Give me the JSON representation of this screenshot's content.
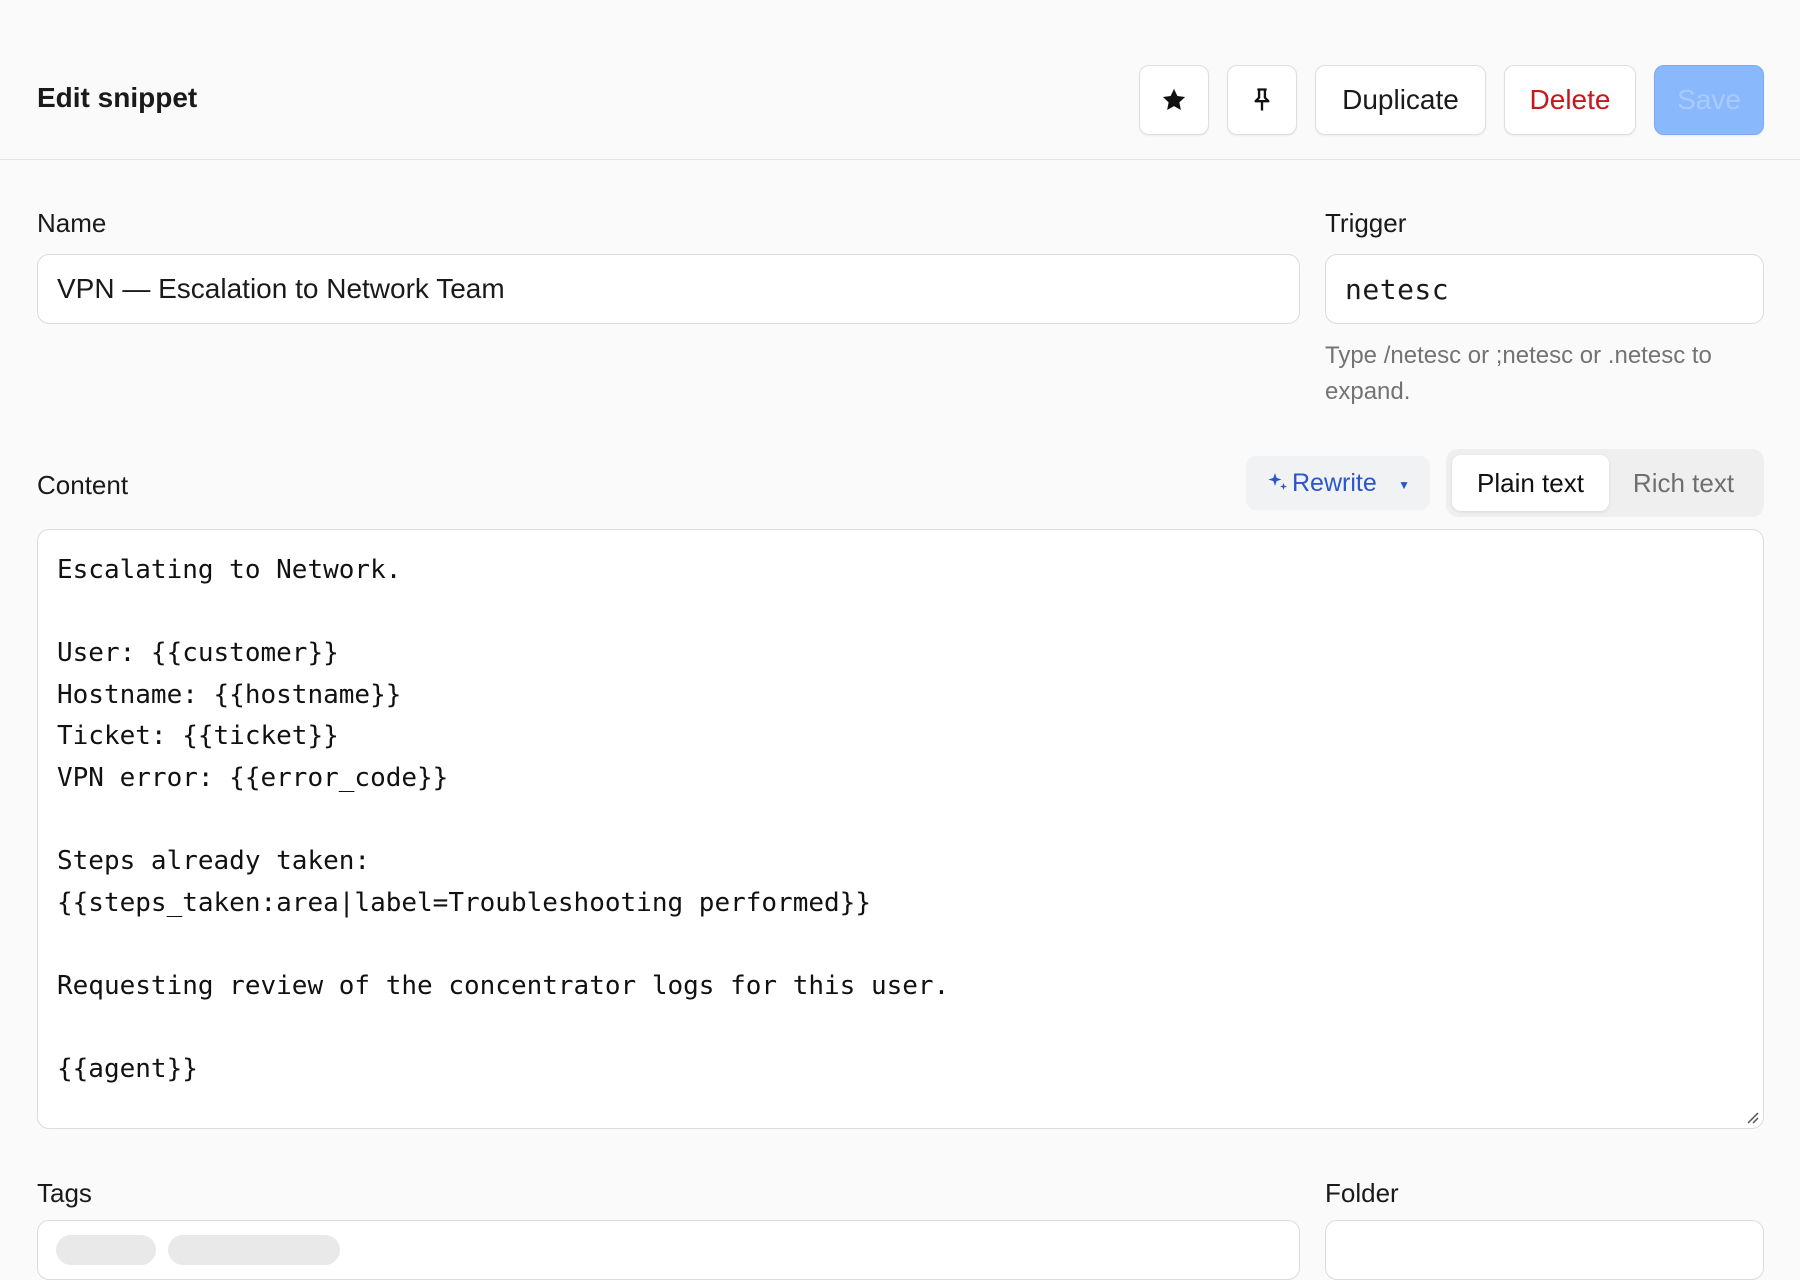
{
  "header": {
    "title": "Edit snippet",
    "star_icon": "star-icon",
    "pin_icon": "pin-icon",
    "duplicate_label": "Duplicate",
    "delete_label": "Delete",
    "save_label": "Save"
  },
  "fields": {
    "name_label": "Name",
    "name_value": "VPN — Escalation to Network Team",
    "trigger_label": "Trigger",
    "trigger_value": "netesc",
    "trigger_hint": "Type /netesc or ;netesc or .netesc to expand."
  },
  "content": {
    "label": "Content",
    "rewrite_label": "Rewrite",
    "mode_plain": "Plain text",
    "mode_rich": "Rich text",
    "selected_mode": "Plain text",
    "body": "Escalating to Network.\n\nUser: {{customer}}\nHostname: {{hostname}}\nTicket: {{ticket}}\nVPN error: {{error_code}}\n\nSteps already taken:\n{{steps_taken:area|label=Troubleshooting performed}}\n\nRequesting review of the concentrator logs for this user.\n\n{{agent}}"
  },
  "tags": {
    "label": "Tags"
  },
  "folder": {
    "label": "Folder"
  },
  "colors": {
    "delete": "#c8161d",
    "save_disabled": "#8ab8fc",
    "rewrite": "#2b56c9"
  }
}
